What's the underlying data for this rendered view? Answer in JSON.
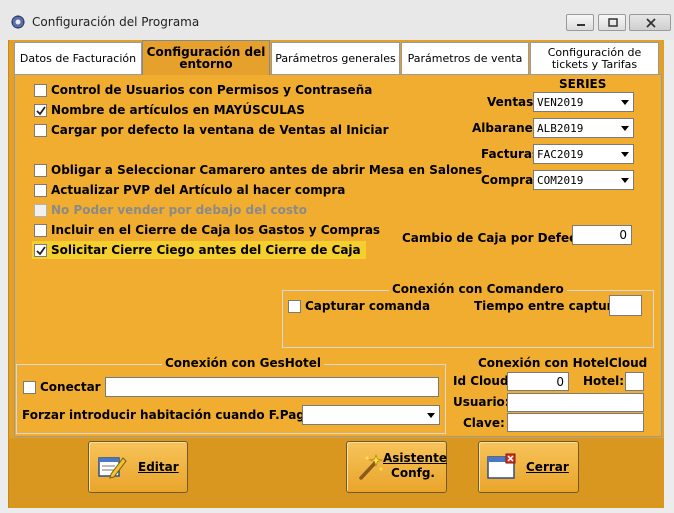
{
  "window": {
    "title": "Configuración del Programa"
  },
  "tabs": [
    {
      "label": "Datos de Facturación",
      "active": false
    },
    {
      "label": "Configuración del entorno",
      "active": true
    },
    {
      "label": "Parámetros generales",
      "active": false
    },
    {
      "label": "Parámetros de venta",
      "active": false
    },
    {
      "label": "Configuración de tickets y Tarifas",
      "active": false
    }
  ],
  "options": [
    {
      "label": "Control de Usuarios con Permisos y Contraseña",
      "checked": false,
      "enabled": true
    },
    {
      "label": "Nombre de artículos en MAYÚSCULAS",
      "checked": true,
      "enabled": true
    },
    {
      "label": "Cargar por defecto la ventana de Ventas al Iniciar",
      "checked": false,
      "enabled": true
    },
    {
      "label": "Obligar a Seleccionar Camarero antes de abrir Mesa en Salones",
      "checked": false,
      "enabled": true
    },
    {
      "label": "Actualizar PVP del Artículo al hacer compra",
      "checked": false,
      "enabled": true
    },
    {
      "label": "No Poder vender por debajo del costo",
      "checked": false,
      "enabled": false
    },
    {
      "label": "Incluir en el Cierre de Caja los Gastos y Compras",
      "checked": false,
      "enabled": true
    },
    {
      "label": "Solicitar Cierre Ciego antes del Cierre de Caja",
      "checked": true,
      "enabled": true,
      "highlighted": true
    }
  ],
  "series": {
    "heading": "SERIES",
    "ventas": {
      "label": "Ventas",
      "value": "VEN2019"
    },
    "albaranes": {
      "label": "Albaranes",
      "value": "ALB2019"
    },
    "facturas": {
      "label": "Facturas",
      "value": "FAC2019"
    },
    "compras": {
      "label": "Compras",
      "value": "COM2019"
    }
  },
  "cambio_caja": {
    "label": "Cambio de Caja por Defecto:",
    "value": "0"
  },
  "comandero": {
    "title": "Conexión con Comandero",
    "capturar_label": "Capturar comanda",
    "capturar_checked": false,
    "tiempo_label": "Tiempo entre capturas",
    "tiempo_value": ""
  },
  "geshotel": {
    "title": "Conexión con GesHotel",
    "conectar_label": "Conectar",
    "conectar_checked": false,
    "conectar_value": "",
    "forzar_label": "Forzar introducir habitación cuando F.Pago sea:",
    "forzar_value": ""
  },
  "hotelcloud": {
    "title": "Conexión con HotelCloud",
    "id_label": "Id Cloud:",
    "id_value": "0",
    "hotel_label": "Hotel:",
    "hotel_value": "",
    "usuario_label": "Usuario:",
    "usuario_value": "",
    "clave_label": "Clave:",
    "clave_value": ""
  },
  "buttons": {
    "editar": "Editar",
    "asistente_line1": "Asistente",
    "asistente_line2": "Confg.",
    "cerrar": "Cerrar"
  },
  "colors": {
    "accent": "#f0ad2f",
    "highlight": "#f4cf2d",
    "button": "#e9a52b"
  }
}
